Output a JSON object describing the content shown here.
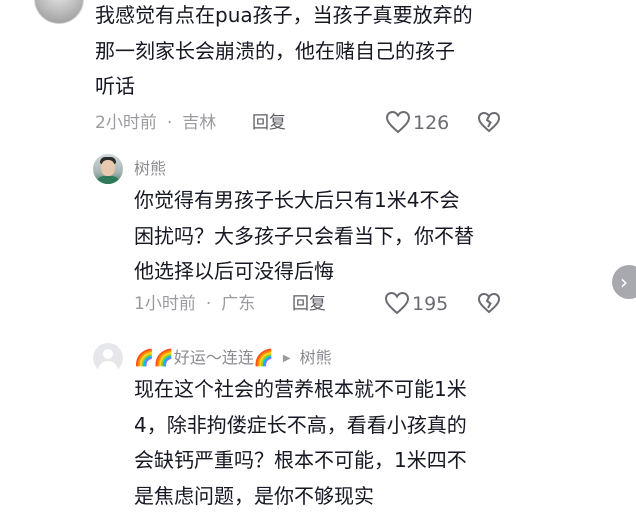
{
  "comments": [
    {
      "text_lines": [
        "我感觉有点在pua孩子，当孩子真要放弃的",
        "那一刻家长会崩溃的，他在赌自己的孩子",
        "听话"
      ],
      "time": "2小时前",
      "location": "吉林",
      "reply_label": "回复",
      "likes": "126"
    },
    {
      "username": "树熊",
      "text_lines": [
        "你觉得有男孩子长大后只有1米4不会",
        "困扰吗？大多孩子只会看当下，你不替",
        "他选择以后可没得后悔"
      ],
      "time": "1小时前",
      "location": "广东",
      "reply_label": "回复",
      "likes": "195"
    },
    {
      "username": "🌈🌈好运～连连🌈",
      "reply_to": "树熊",
      "text_lines": [
        "现在这个社会的营养根本就不可能1米",
        "4，除非拘偻症长不高，看看小孩真的",
        "会缺钙严重吗？根本不可能，1米四不",
        "是焦虑问题，是你不够现实"
      ]
    }
  ],
  "separator_dot": "·",
  "icons": {
    "like": "heart-outline-icon",
    "dislike": "broken-heart-icon",
    "reply_arrow": "play-triangle-icon",
    "scroll": "chevron-right-icon"
  },
  "colors": {
    "text": "#161823",
    "meta": "#9a9ba1",
    "icon": "#6b6c73"
  }
}
